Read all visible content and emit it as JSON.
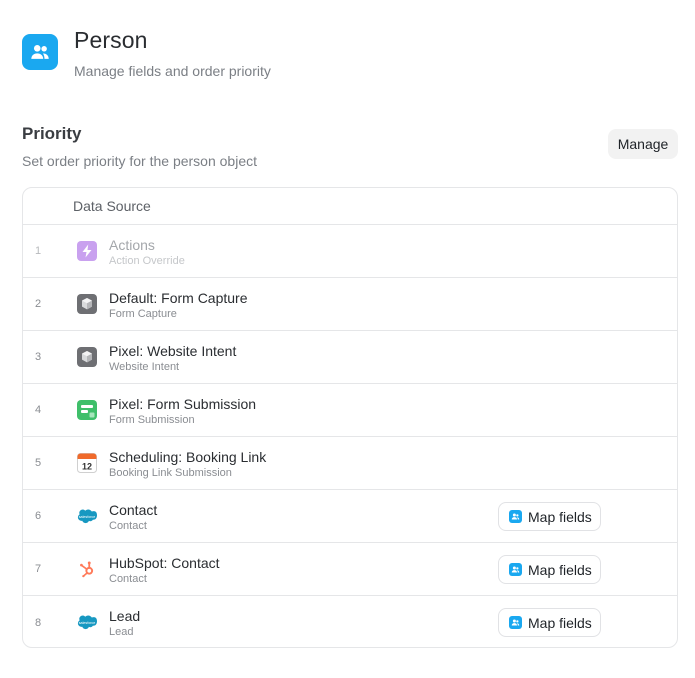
{
  "header": {
    "icon": "people-icon",
    "icon_color": "#1aa8f0",
    "title": "Person",
    "subtitle": "Manage fields and order priority"
  },
  "priority": {
    "title": "Priority",
    "subtitle": "Set order priority for the person object",
    "manage_label": "Manage"
  },
  "table": {
    "column_header": "Data Source",
    "rows": [
      {
        "num": "1",
        "title": "Actions",
        "desc": "Action Override",
        "icon": "lightning-icon",
        "disabled": true,
        "map_fields": null
      },
      {
        "num": "2",
        "title": "Default: Form Capture",
        "desc": "Form Capture",
        "icon": "cube-icon",
        "disabled": false,
        "map_fields": null
      },
      {
        "num": "3",
        "title": "Pixel: Website Intent",
        "desc": "Website Intent",
        "icon": "cube-icon",
        "disabled": false,
        "map_fields": null
      },
      {
        "num": "4",
        "title": "Pixel: Form Submission",
        "desc": "Form Submission",
        "icon": "form-icon",
        "disabled": false,
        "map_fields": null
      },
      {
        "num": "5",
        "title": "Scheduling: Booking Link",
        "desc": "Booking Link Submission",
        "icon": "calendar-icon",
        "icon_text": "12",
        "disabled": false,
        "map_fields": null
      },
      {
        "num": "6",
        "title": "Contact",
        "desc": "Contact",
        "icon": "salesforce-icon",
        "disabled": false,
        "map_fields": "Map fields"
      },
      {
        "num": "7",
        "title": "HubSpot: Contact",
        "desc": "Contact",
        "icon": "hubspot-icon",
        "disabled": false,
        "map_fields": "Map fields"
      },
      {
        "num": "8",
        "title": "Lead",
        "desc": "Lead",
        "icon": "salesforce-icon",
        "disabled": false,
        "map_fields": "Map fields"
      }
    ]
  },
  "colors": {
    "accent": "#1aa8f0",
    "salesforce": "#1798c1",
    "hubspot": "#ff7a59",
    "form_green": "#3fbf6a",
    "action_purple": "#b983e8"
  }
}
